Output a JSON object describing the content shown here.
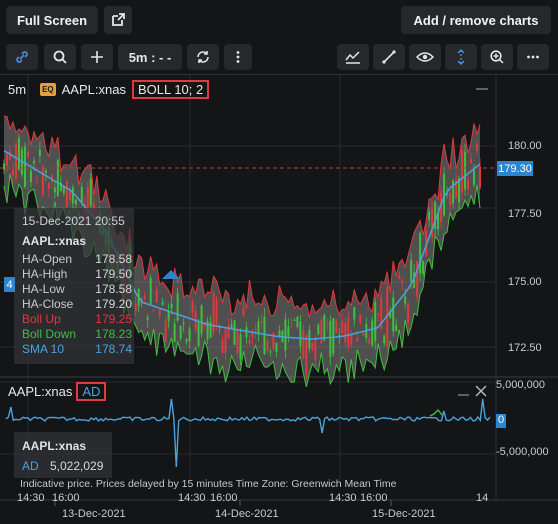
{
  "topbar": {
    "fullscreen_label": "Full Screen",
    "add_remove_label": "Add / remove charts"
  },
  "toolbar": {
    "interval_label": "5m : - -",
    "icons": [
      "link-icon",
      "search-icon",
      "plus-icon",
      "interval-selector",
      "refresh-icon",
      "more-vertical-icon",
      "indicators-icon",
      "draw-line-icon",
      "eye-icon",
      "crosshair-icon",
      "zoom-in-icon",
      "more-horizontal-icon"
    ]
  },
  "main_chart": {
    "interval": "5m",
    "badge": "EQ",
    "symbol": "AAPL:xnas",
    "indicator": "BOLL 10; 2",
    "last_price": "179.30",
    "tooltip": {
      "date": "15-Dec-2021 20:55",
      "symbol": "AAPL:xnas",
      "rows": [
        {
          "label": "HA-Open",
          "value": "178.58",
          "color": "#c9cbce"
        },
        {
          "label": "HA-High",
          "value": "179.50",
          "color": "#c9cbce"
        },
        {
          "label": "HA-Low",
          "value": "178.58",
          "color": "#c9cbce"
        },
        {
          "label": "HA-Close",
          "value": "179.20",
          "color": "#c9cbce"
        },
        {
          "label": "Boll Up",
          "value": "179.25",
          "color": "#e0393e"
        },
        {
          "label": "Boll Down",
          "value": "178.23",
          "color": "#3fbf3f"
        },
        {
          "label": "SMA 10",
          "value": "178.74",
          "color": "#4aa3e0"
        }
      ]
    },
    "y_ticks": [
      "180.00",
      "177.50",
      "175.00",
      "172.50"
    ],
    "side_marker": "4"
  },
  "sub_chart": {
    "symbol": "AAPL:xnas",
    "indicator": "AD",
    "y_ticks": [
      "5,000,000",
      "0",
      "-5,000,000"
    ],
    "tooltip": {
      "symbol": "AAPL:xnas",
      "label": "AD",
      "value": "5,022,029"
    }
  },
  "footnote": "Indicative price. Prices delayed by 15 minutes    Time Zone: Greenwich Mean Time",
  "x_time_labels": [
    "14:30",
    "16:00",
    "14:30",
    "16:00",
    "14:30",
    "16:00",
    "14:30",
    "16:00",
    "14"
  ],
  "x_date_labels": [
    "13-Dec-2021",
    "14-Dec-2021",
    "15-Dec-2021"
  ],
  "chart_data": {
    "type": "line",
    "x": [
      "13-Dec-2021",
      "14-Dec-2021",
      "15-Dec-2021"
    ],
    "ylim": [
      171.5,
      181.5
    ],
    "series": [
      {
        "name": "SMA 10",
        "values": [
          179.2,
          178.5,
          177.8,
          176.4,
          174.0,
          173.6,
          173.2,
          173.0,
          172.8,
          172.7,
          172.8,
          173.1,
          174.6,
          177.8,
          178.74
        ]
      }
    ],
    "colors": {
      "boll_up": "#e0393e",
      "boll_down": "#3fbf3f",
      "sma": "#4aa3e0",
      "ad": "#4aa3e0",
      "price_tag": "#2a86d1"
    }
  }
}
